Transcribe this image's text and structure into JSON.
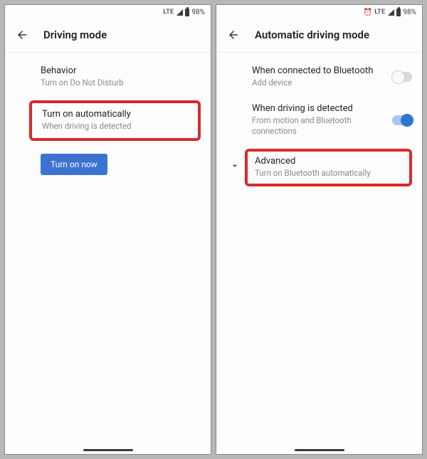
{
  "status": {
    "lte": "LTE",
    "battery": "98%"
  },
  "left": {
    "title": "Driving mode",
    "behavior": {
      "title": "Behavior",
      "sub": "Turn on Do Not Disturb"
    },
    "auto": {
      "title": "Turn on automatically",
      "sub": "When driving is detected"
    },
    "button": "Turn on now"
  },
  "right": {
    "title": "Automatic driving mode",
    "bt": {
      "title": "When connected to Bluetooth",
      "sub": "Add device"
    },
    "driving": {
      "title": "When driving is detected",
      "sub": "From motion and Bluetooth connections"
    },
    "advanced": {
      "title": "Advanced",
      "sub": "Turn on Bluetooth automatically"
    }
  }
}
